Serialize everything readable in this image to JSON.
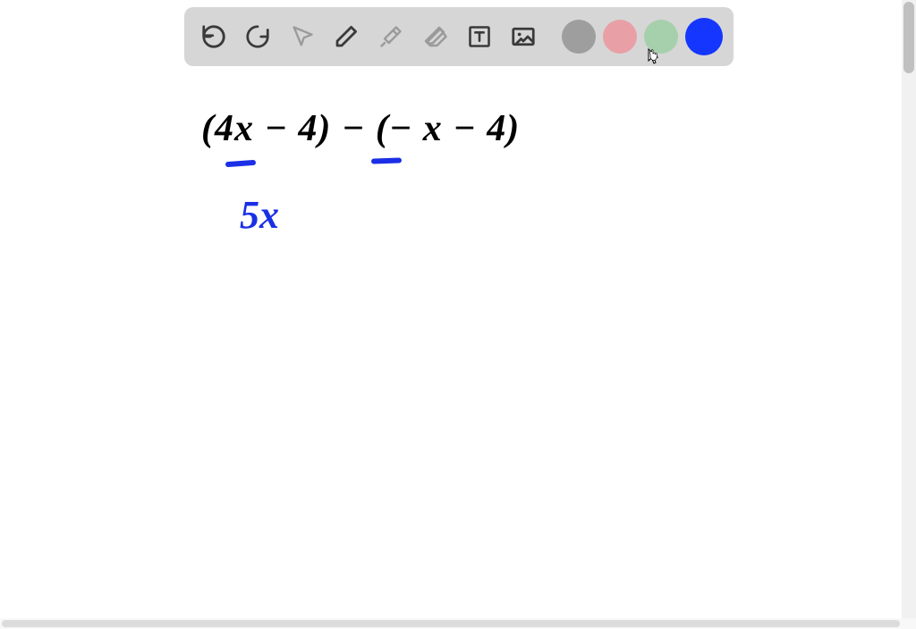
{
  "toolbar": {
    "tools": {
      "undo": "undo",
      "redo": "redo",
      "pointer": "pointer",
      "pen": "pen",
      "tools_misc": "tools",
      "eraser": "eraser",
      "text": "text",
      "image": "image"
    },
    "colors": {
      "gray": "#9e9e9e",
      "pink": "#e8a0a6",
      "green": "#a6d0ab",
      "blue": "#1436ff"
    },
    "selected_color": "blue"
  },
  "canvas": {
    "expression_line1": "(4x − 4) − (− x − 4)",
    "result": "5x",
    "ink_color_black": "#000000",
    "ink_color_blue": "#1a2fe6"
  }
}
